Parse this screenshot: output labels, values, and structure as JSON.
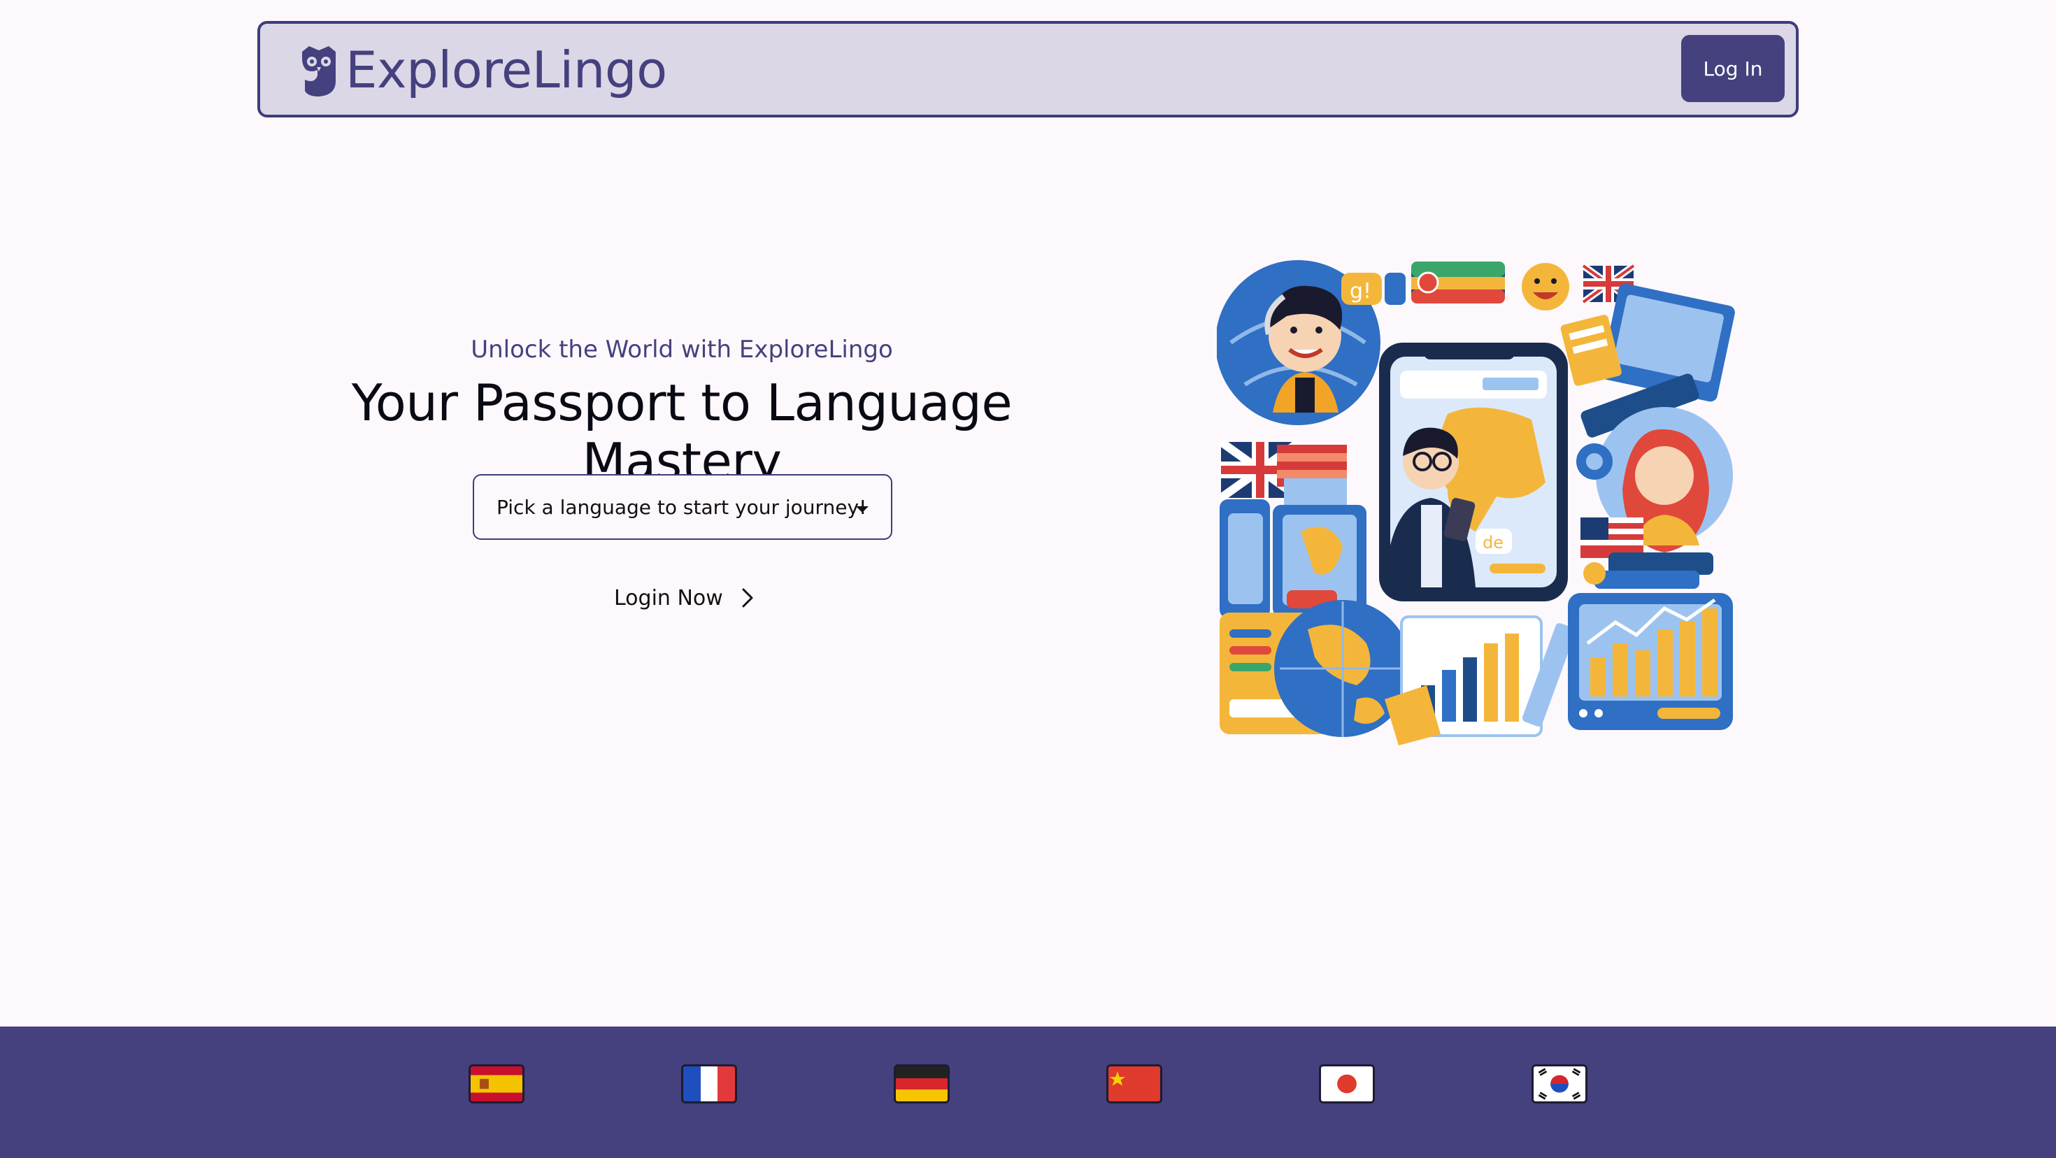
{
  "header": {
    "brand": "ExploreLingo",
    "login_label": "Log In"
  },
  "hero": {
    "tagline": "Unlock the World with ExploreLingo",
    "headline": "Your Passport to Language Mastery",
    "language_picker": {
      "selected": "Pick a language to start your journey!"
    },
    "login_link": "Login Now"
  },
  "illustration": {
    "bubble_text_1": "g!",
    "bubble_text_2": "de"
  },
  "footer": {
    "flags": [
      "spain-flag-icon",
      "france-flag-icon",
      "germany-flag-icon",
      "china-flag-icon",
      "japan-flag-icon",
      "south-korea-flag-icon"
    ]
  },
  "colors": {
    "primary": "#45417e",
    "header_bg": "#dcd7e6",
    "page_bg": "#fdf8fc"
  }
}
